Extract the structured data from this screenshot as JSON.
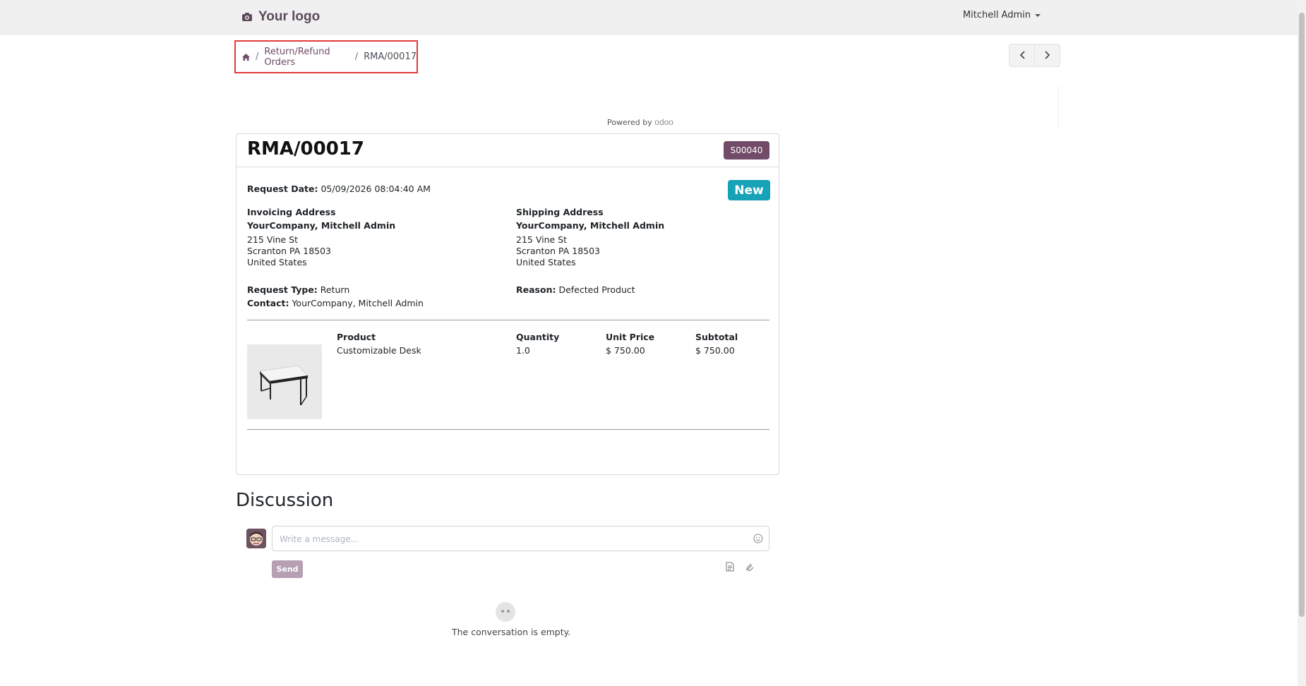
{
  "header": {
    "logo_text": "Your logo",
    "user_name": "Mitchell Admin"
  },
  "breadcrumb": {
    "parent": "Return/Refund Orders",
    "current": "RMA/00017",
    "separator": "/"
  },
  "powered_by": {
    "prefix": "Powered by",
    "brand": "odoo"
  },
  "rma": {
    "title": "RMA/00017",
    "sale_order": "S00040",
    "status": "New",
    "request_date_label": "Request Date:",
    "request_date": "05/09/2026 08:04:40 AM",
    "invoicing": {
      "label": "Invoicing Address",
      "name": "YourCompany, Mitchell Admin",
      "line1": "215 Vine St",
      "line2": "Scranton PA 18503",
      "line3": "United States"
    },
    "shipping": {
      "label": "Shipping Address",
      "name": "YourCompany, Mitchell Admin",
      "line1": "215 Vine St",
      "line2": "Scranton PA 18503",
      "line3": "United States"
    },
    "request_type_label": "Request Type:",
    "request_type": "Return",
    "reason_label": "Reason:",
    "reason": "Defected Product",
    "contact_label": "Contact:",
    "contact": "YourCompany, Mitchell Admin",
    "table": {
      "columns": [
        "Product",
        "Quantity",
        "Unit Price",
        "Subtotal"
      ],
      "rows": [
        {
          "product": "Customizable Desk",
          "quantity": "1.0",
          "unit_price": "$ 750.00",
          "subtotal": "$ 750.00"
        }
      ]
    }
  },
  "discussion": {
    "title": "Discussion",
    "placeholder": "Write a message...",
    "send_label": "Send",
    "empty_text": "The conversation is empty."
  },
  "colors": {
    "brand": "#714b67",
    "status_new": "#17a2b8",
    "highlight_box": "#e23b3b"
  }
}
